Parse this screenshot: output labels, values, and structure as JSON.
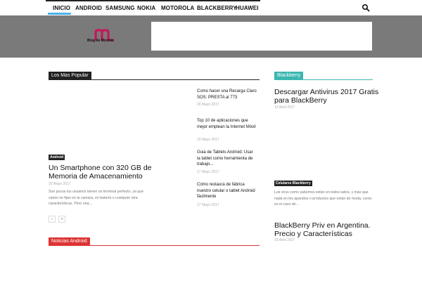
{
  "nav": {
    "items": [
      {
        "label": "INICIO"
      },
      {
        "label": "ANDROID"
      },
      {
        "label": "SAMSUNG"
      },
      {
        "label": "NOKIA"
      },
      {
        "label": "MOTOROLA"
      },
      {
        "label": "BLACKBERRY"
      },
      {
        "label": "HUAWEI"
      }
    ],
    "accent": "#4db2ec"
  },
  "header": {
    "logo_text": "Blog de Móviles",
    "background": "#7a7a7a"
  },
  "popular": {
    "heading": "Los Mas Popular",
    "feature": {
      "badge": "Android",
      "title": "Un Smartphone con 320 GB de Memoria de Amacenamiento",
      "date": "20 Mayo 2017",
      "excerpt": "Son pocos los usuarios tienen un terminal perfecto, ya que varios se fijan en la camara, en batería o cuelquier otra características. Pero una..."
    },
    "list": [
      {
        "title": "Como hacer una Recarga Claro SOS: PRESTA al 773",
        "date": "20 Mayo 2017"
      },
      {
        "title": "Top 10 de aplicaciones que mejor emplean la Internet Móvil",
        "date": "19 Mayo 2017"
      },
      {
        "title": "Guia de Tablets Android: Usar la tablet como herramienta de trabajo...",
        "date": "17 Mayo 2017"
      },
      {
        "title": "Cómo restaura de fábrica nuestro celular o tablet Android fácilmente",
        "date": "17 Mayo 2017"
      }
    ],
    "pager": {
      "prev": "‹",
      "next": "›"
    },
    "color": "#222222"
  },
  "noticias": {
    "heading": "Noticias Android",
    "color": "#dd3333"
  },
  "blackberry": {
    "heading": "Blackberry",
    "color": "#3bb6b0",
    "post1": {
      "title": "Descargar Antivirus 2017 Gratis para BlackBerry",
      "date": "12 Abril 2017"
    },
    "badge": "Celulares Blackberry",
    "excerpt": "Los virus como sabemos están en todos lados, y más que nada en los aparatos o productos que están de moda, como es el caso de...",
    "post2": {
      "title": "BlackBerry Priv en Argentina. Precio y Características",
      "date": "15 Abril 2017"
    }
  }
}
